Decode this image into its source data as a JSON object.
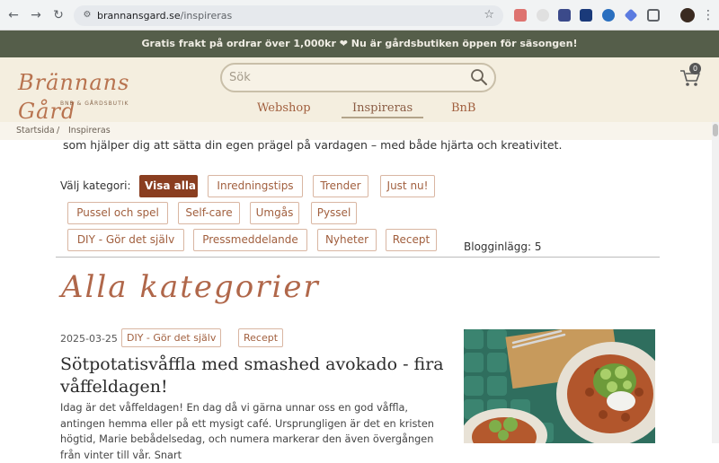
{
  "browser": {
    "url_host": "brannansgard.se",
    "url_path": "/inspireras"
  },
  "promo": {
    "text": "Gratis frakt på ordrar över 1,000kr ❤ Nu är gårdsbutiken öppen för säsongen!"
  },
  "header": {
    "logo_text": "Brännans Gård",
    "logo_sub": "BNB & GÅRDSBUTIK",
    "search_placeholder": "Sök",
    "cart_count": "0",
    "nav": [
      {
        "label": "Webshop"
      },
      {
        "label": "Inspireras",
        "active": true
      },
      {
        "label": "BnB"
      }
    ]
  },
  "breadcrumb": {
    "home": "Startsida",
    "separator": "/",
    "current": "Inspireras"
  },
  "intro": "som hjälper dig att sätta din egen prägel på vardagen – med både hjärta och kreativitet.",
  "categories": {
    "label": "Välj kategori:",
    "items": [
      "Visa alla",
      "Inredningstips",
      "Trender",
      "Just nu!",
      "Pussel och spel",
      "Self-care",
      "Umgås",
      "Pyssel",
      "DIY - Gör det själv",
      "Pressmeddelande",
      "Nyheter",
      "Recept"
    ],
    "active_index": 0,
    "post_count": "Blogginlägg: 5"
  },
  "section_title": "Alla kategorier",
  "post": {
    "date": "2025-03-25",
    "tags": [
      "DIY - Gör det själv",
      "Recept"
    ],
    "title": "Sötpotatisvåffla med smashed avokado - fira våffeldagen!",
    "excerpt": "Idag är det våffeldagen! En dag då vi gärna unnar oss en god våffla, antingen hemma eller på ett mysigt café. Ursprungligen är det en kristen högtid, Marie bebådelsedag, och numera markerar den även övergången från vinter till vår. Snart"
  },
  "colors": {
    "promo_bg": "#555e4a",
    "header_bg": "#f4eedf",
    "accent": "#a15f3e",
    "active_chip": "#8a3e20"
  }
}
